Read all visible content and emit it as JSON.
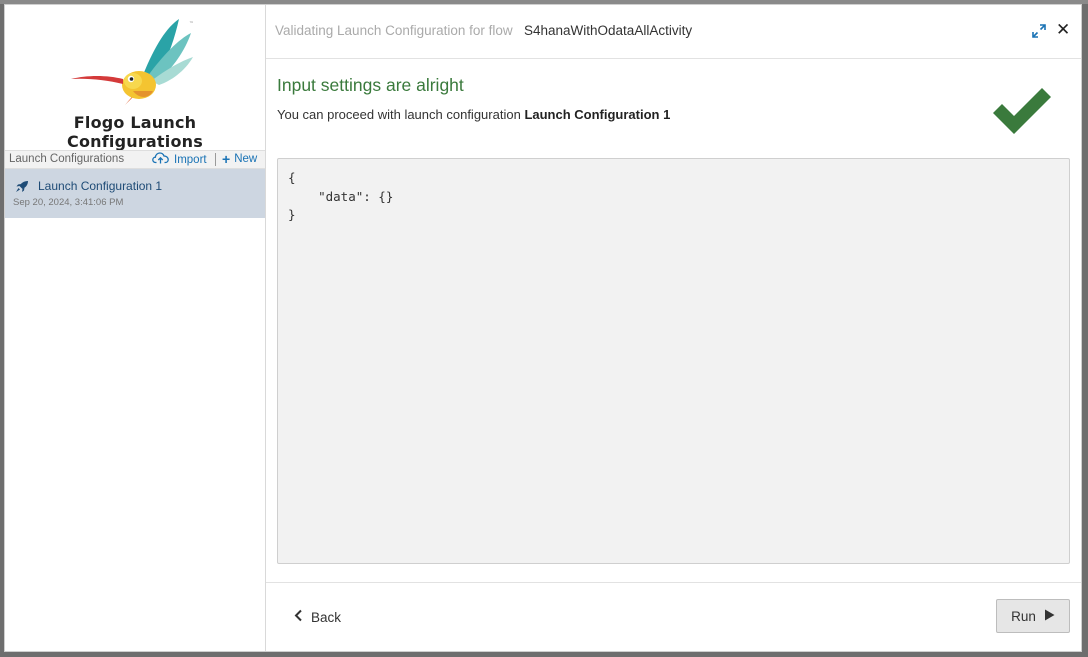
{
  "sidebar": {
    "brand": "Flogo Launch Configurations",
    "list_header": "Launch Configurations",
    "import_label": "Import",
    "new_label": "New",
    "items": [
      {
        "name": "Launch Configuration 1",
        "date": "Sep 20, 2024, 3:41:06 PM"
      }
    ]
  },
  "header": {
    "validating_text": "Validating Launch Configuration for flow",
    "flow_name": "S4hanaWithOdataAllActivity"
  },
  "result": {
    "heading": "Input settings are alright",
    "message_prefix": "You can proceed with launch configuration",
    "config_name": "Launch Configuration 1"
  },
  "json_content": "{\n    \"data\": {}\n}",
  "footer": {
    "back_label": "Back",
    "run_label": "Run"
  },
  "colors": {
    "success": "#3a7a3c",
    "link": "#1a73b5",
    "selected_item_bg": "#cdd6e1"
  },
  "icons": {
    "logo": "hummingbird-logo",
    "import": "cloud-upload-icon",
    "new": "plus-icon",
    "item": "rocket-icon",
    "expand": "expand-icon",
    "close": "close-icon",
    "success": "checkmark-icon",
    "back": "chevron-left-icon",
    "run": "play-icon"
  }
}
